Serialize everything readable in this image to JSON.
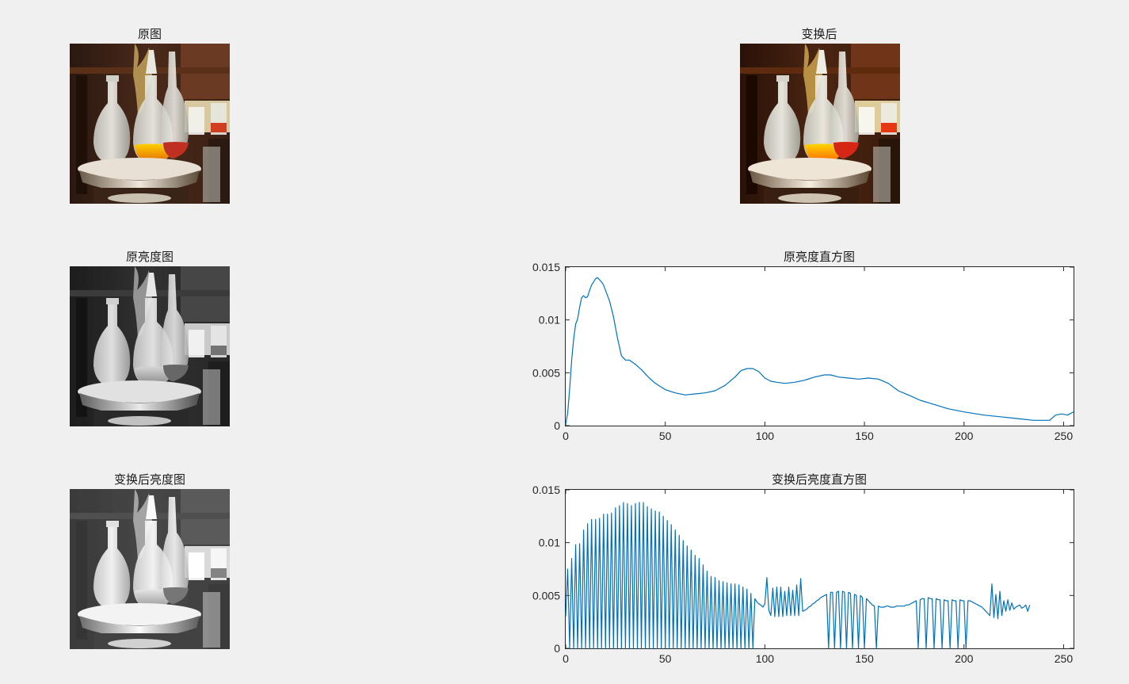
{
  "titles": {
    "original": "原图",
    "transformed": "变换后",
    "original_gray": "原亮度图",
    "original_hist": "原亮度直方图",
    "transformed_gray": "变换后亮度图",
    "transformed_hist": "变换后亮度直方图"
  },
  "colors": {
    "background": "#f0f0f0",
    "line": "#0072BD",
    "axes": "#262626"
  },
  "chart_data": [
    {
      "type": "line",
      "title": "原亮度直方图",
      "xlim": [
        0,
        255
      ],
      "ylim": [
        0,
        0.015
      ],
      "xticks": [
        0,
        50,
        100,
        150,
        200,
        250
      ],
      "yticks": [
        0,
        0.005,
        0.01,
        0.015
      ],
      "xtick_labels": [
        "0",
        "50",
        "100",
        "150",
        "200",
        "250"
      ],
      "ytick_labels": [
        "0",
        "0.005",
        "0.01",
        "0.015"
      ],
      "x": [
        0,
        1,
        2,
        3,
        4,
        5,
        6,
        7,
        8,
        9,
        10,
        11,
        12,
        13,
        14,
        15,
        16,
        17,
        18,
        19,
        20,
        22,
        24,
        26,
        28,
        30,
        32,
        35,
        38,
        40,
        42,
        45,
        50,
        55,
        60,
        65,
        70,
        75,
        80,
        85,
        88,
        91,
        94,
        97,
        100,
        103,
        106,
        110,
        115,
        120,
        125,
        130,
        133,
        137,
        142,
        147,
        152,
        157,
        162,
        167,
        172,
        178,
        185,
        192,
        200,
        210,
        220,
        230,
        235,
        240,
        243,
        246,
        249,
        252,
        255
      ],
      "y": [
        0.0001,
        0.0012,
        0.0035,
        0.0062,
        0.0082,
        0.0096,
        0.0101,
        0.0112,
        0.0121,
        0.0123,
        0.0121,
        0.0122,
        0.0128,
        0.0133,
        0.0136,
        0.0139,
        0.014,
        0.0138,
        0.0136,
        0.0133,
        0.0128,
        0.0118,
        0.0103,
        0.0083,
        0.0066,
        0.0062,
        0.0062,
        0.0058,
        0.0053,
        0.0049,
        0.0045,
        0.004,
        0.0034,
        0.0031,
        0.0029,
        0.003,
        0.0031,
        0.0033,
        0.0038,
        0.0046,
        0.0052,
        0.0054,
        0.0054,
        0.0051,
        0.0045,
        0.0042,
        0.0041,
        0.004,
        0.0041,
        0.0043,
        0.0046,
        0.0048,
        0.0048,
        0.0046,
        0.0045,
        0.0044,
        0.0045,
        0.0044,
        0.004,
        0.0033,
        0.0029,
        0.0024,
        0.002,
        0.0016,
        0.0013,
        0.001,
        0.0008,
        0.0006,
        0.0005,
        0.0005,
        0.0005,
        0.001,
        0.0011,
        0.001,
        0.0013
      ]
    },
    {
      "type": "line",
      "title": "变换后亮度直方图",
      "xlim": [
        0,
        255
      ],
      "ylim": [
        0,
        0.015
      ],
      "xticks": [
        0,
        50,
        100,
        150,
        200,
        250
      ],
      "yticks": [
        0,
        0.005,
        0.01,
        0.015
      ],
      "xtick_labels": [
        "0",
        "50",
        "100",
        "150",
        "200",
        "250"
      ],
      "ytick_labels": [
        "0",
        "0.005",
        "0.01",
        "0.015"
      ],
      "x": [
        0,
        1,
        2,
        3,
        4,
        5,
        6,
        7,
        8,
        9,
        10,
        11,
        12,
        13,
        14,
        15,
        16,
        17,
        18,
        19,
        20,
        21,
        22,
        23,
        24,
        25,
        26,
        27,
        28,
        29,
        30,
        31,
        32,
        33,
        34,
        35,
        36,
        37,
        38,
        39,
        40,
        41,
        42,
        43,
        44,
        45,
        46,
        47,
        48,
        49,
        50,
        51,
        52,
        53,
        54,
        55,
        56,
        57,
        58,
        59,
        60,
        61,
        62,
        63,
        64,
        65,
        66,
        67,
        68,
        69,
        70,
        71,
        72,
        73,
        74,
        75,
        76,
        77,
        78,
        79,
        80,
        81,
        82,
        83,
        84,
        85,
        86,
        87,
        88,
        89,
        90,
        91,
        92,
        93,
        94,
        95,
        96,
        97,
        98,
        99,
        100,
        101,
        102,
        103,
        104,
        105,
        106,
        107,
        108,
        109,
        110,
        111,
        112,
        113,
        114,
        115,
        116,
        117,
        118,
        119,
        120,
        121,
        122,
        123,
        124,
        125,
        126,
        127,
        128,
        129,
        130,
        131,
        132,
        133,
        134,
        135,
        136,
        137,
        138,
        139,
        140,
        141,
        142,
        143,
        144,
        145,
        146,
        147,
        148,
        149,
        150,
        151,
        152,
        153,
        154,
        155,
        156,
        157,
        158,
        159,
        160,
        161,
        162,
        163,
        164,
        165,
        166,
        167,
        168,
        169,
        170,
        171,
        172,
        173,
        174,
        175,
        176,
        177,
        178,
        179,
        180,
        181,
        182,
        183,
        184,
        185,
        186,
        187,
        188,
        189,
        190,
        191,
        192,
        193,
        194,
        195,
        196,
        197,
        198,
        199,
        200,
        201,
        202,
        203,
        204,
        205,
        206,
        207,
        208,
        209,
        210,
        211,
        212,
        213,
        214,
        215,
        216,
        217,
        218,
        219,
        220,
        221,
        222,
        223,
        224,
        225,
        226,
        227,
        228,
        229,
        230,
        231,
        232,
        233,
        234,
        235,
        236,
        237,
        238,
        239,
        240,
        241,
        242,
        243,
        244,
        245,
        246,
        247,
        248,
        249,
        250,
        251,
        252,
        253,
        254,
        255
      ],
      "y": [
        0.003,
        0.0075,
        0,
        0.0085,
        0,
        0.0098,
        0,
        0.0099,
        0,
        0.0112,
        0,
        0.0118,
        0,
        0.0122,
        0,
        0.0122,
        0,
        0.0123,
        0,
        0.0127,
        0,
        0.0127,
        0,
        0.0128,
        0,
        0.0133,
        0,
        0.0135,
        0,
        0.0138,
        0,
        0.0137,
        0,
        0.0135,
        0,
        0.0137,
        0,
        0.0138,
        0,
        0.0138,
        0,
        0.0134,
        0,
        0.0132,
        0,
        0.013,
        0,
        0.0129,
        0,
        0.0125,
        0,
        0.0121,
        0,
        0.0117,
        0,
        0.0112,
        0,
        0.0107,
        0,
        0.0102,
        0,
        0.0097,
        0,
        0.0093,
        0,
        0.0088,
        0,
        0.0085,
        0,
        0.0079,
        0,
        0.0073,
        0,
        0.0068,
        0,
        0.0067,
        0,
        0.0064,
        0,
        0.0063,
        0,
        0.0062,
        0,
        0.0061,
        0,
        0.0061,
        0,
        0.006,
        0,
        0.0058,
        0,
        0.0056,
        0,
        0.0052,
        0,
        0.0047,
        0.0044,
        0.0042,
        0.0041,
        0.0039,
        0.0042,
        0.0067,
        0.0036,
        0.0031,
        0.0057,
        0.003,
        0.0058,
        0.003,
        0.0058,
        0.003,
        0.0054,
        0.0031,
        0.0058,
        0.0031,
        0.0055,
        0.0031,
        0.006,
        0.0031,
        0.0066,
        0.0035,
        0.0036,
        0.0037,
        0.0039,
        0.004,
        0.0042,
        0.0043,
        0.0045,
        0.0046,
        0.0048,
        0.0049,
        0.005,
        0.0051,
        0,
        0.0053,
        0.0053,
        0,
        0.0053,
        0.0054,
        0,
        0.0054,
        0.0053,
        0,
        0.0053,
        0.0052,
        0,
        0.0051,
        0.005,
        0,
        0.005,
        0.0048,
        0,
        0.0047,
        0.0045,
        0.0043,
        0.0041,
        0.004,
        0,
        0.004,
        0.0039,
        0.0039,
        0.0039,
        0.004,
        0.004,
        0.0039,
        0.0039,
        0.0039,
        0.004,
        0.004,
        0.004,
        0.004,
        0.004,
        0.0041,
        0.0041,
        0.0042,
        0.0043,
        0.0044,
        0.0045,
        0,
        0.0046,
        0.0047,
        0.0047,
        0,
        0.0048,
        0.0047,
        0.0047,
        0,
        0.0047,
        0.0046,
        0.0046,
        0,
        0.0046,
        0.0045,
        0.0045,
        0,
        0.0046,
        0.0045,
        0.0045,
        0,
        0.0046,
        0.0045,
        0.0045,
        0,
        0.0045,
        0.0045,
        0.0044,
        0.0043,
        0.0042,
        0.0041,
        0.004,
        0.0039,
        0.0037,
        0.0035,
        0.0033,
        0.0031,
        0.0061,
        0.0029,
        0.0051,
        0.0028,
        0.0054,
        0.0031,
        0.0045,
        0.0035,
        0.0046,
        0.0036,
        0.0043,
        0.0037,
        0.0039,
        0.004,
        0.0041,
        0.0038,
        0.0039,
        0.0041,
        0.0035,
        0.0041
      ]
    }
  ]
}
